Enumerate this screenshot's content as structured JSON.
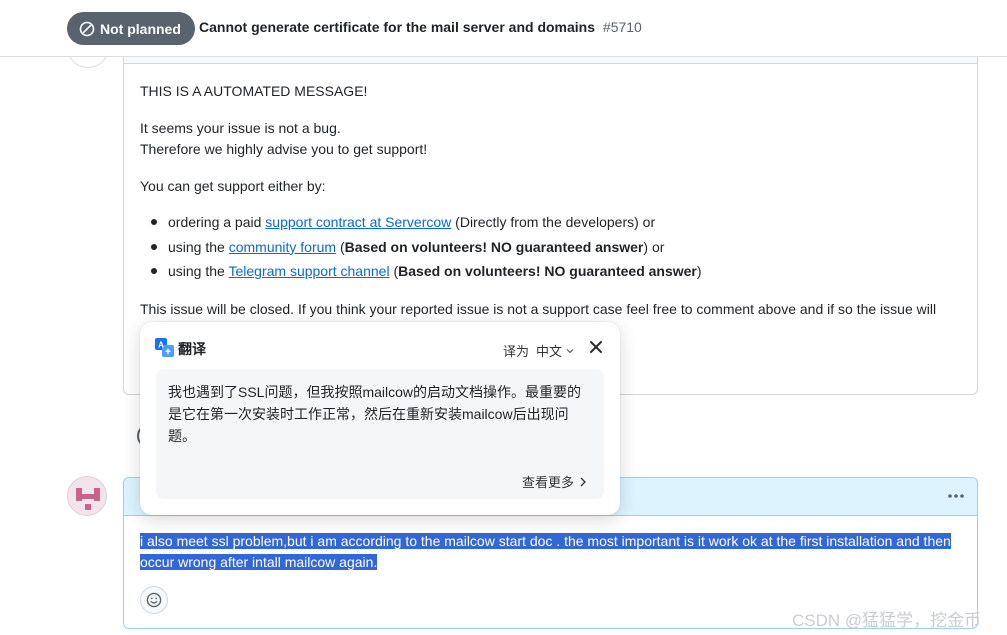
{
  "header": {
    "state_badge": "Not planned",
    "issue_title": "Cannot generate certificate for the mail server and domains",
    "issue_number": "#5710"
  },
  "bot_comment": {
    "automated": "THIS IS A AUTOMATED MESSAGE!",
    "not_bug": "It seems your issue is not a bug.",
    "advise": "Therefore we highly advise you to get support!",
    "support_intro": "You can get support either by:",
    "items": [
      {
        "prefix": "ordering a paid ",
        "link": "support contract at Servercow",
        "suffix": " (Directly from the developers) or",
        "bold": ""
      },
      {
        "prefix": "using the ",
        "link": "community forum",
        "suffix_open": " (",
        "bold": "Based on volunteers! NO guaranteed answer",
        "suffix": ") or"
      },
      {
        "prefix": "using the ",
        "link": "Telegram support channel",
        "suffix_open": " (",
        "bold": "Based on volunteers! NO guaranteed answer",
        "suffix": ")"
      }
    ],
    "closed_note": "This issue will be closed. If you think your reported issue is not a support case feel free to comment above and if so the issue will"
  },
  "user_comment": {
    "text": "i also meet ssl problem,but i am according to the mailcow start doc . the most important is it work ok at the first installation and then occur wrong after intall mailcow again."
  },
  "translate_popup": {
    "title": "翻译",
    "translate_to": "译为",
    "language": "中文",
    "result": "我也遇到了SSL问题，但我按照mailcow的启动文档操作。最重要的是它在第一次安装时工作正常，然后在重新安装mailcow后出现问题。",
    "see_more": "查看更多"
  },
  "watermark": "CSDN @猛猛学，挖金币",
  "colors": {
    "badge": "#59636e",
    "link": "#0969da",
    "selection": "#3367d6",
    "highlight_header": "#ddf4ff"
  }
}
